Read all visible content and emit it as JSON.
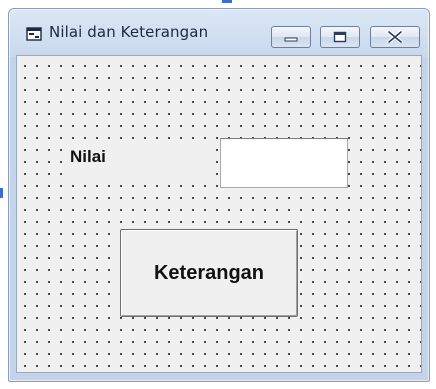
{
  "window": {
    "title": "Nilai dan Keterangan",
    "icons": {
      "app": "form-icon",
      "minimize": "minimize-icon",
      "maximize": "maximize-icon",
      "close": "close-icon"
    }
  },
  "form": {
    "nilai_label": "Nilai",
    "nilai_value": "",
    "keterangan_button": "Keterangan"
  },
  "colors": {
    "titlebar": "#c9d9ee",
    "client": "#f0f0f0",
    "grid_dots": "#1f1f1f",
    "selection_handle": "#3a6fd0"
  }
}
